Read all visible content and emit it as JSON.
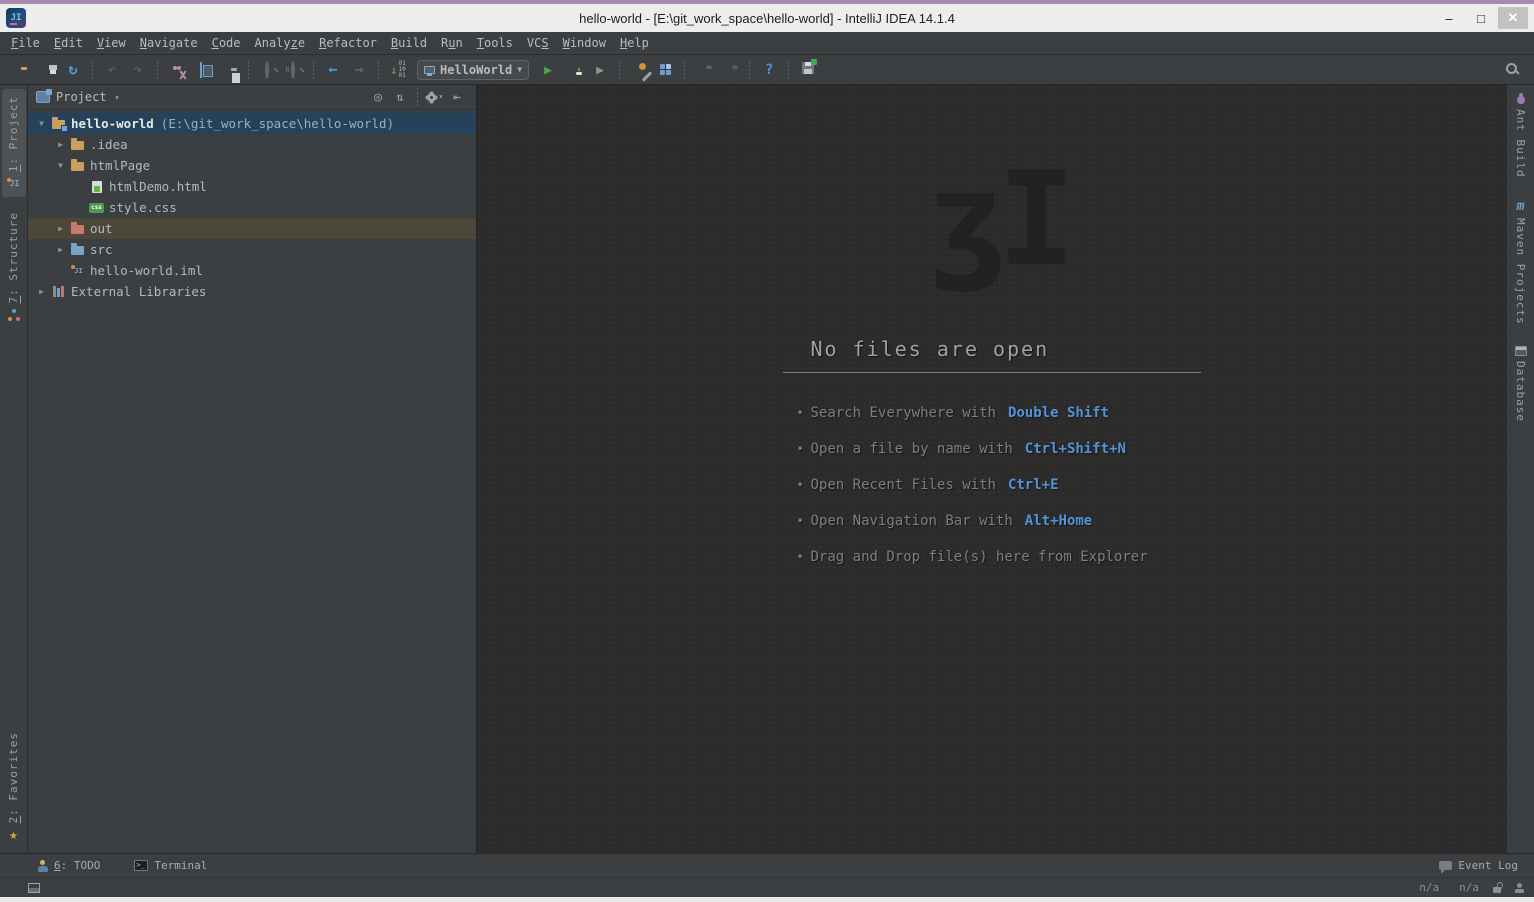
{
  "colors": {
    "accent_blue": "#5394D7",
    "selection_blue": "#25415C",
    "drop_highlight_olive": "#4B4839",
    "panel_gray": "#3C3F41",
    "editor_gray": "#2B2B2B",
    "run_green": "#4CA64C",
    "titlebar_light": "#EDEDED",
    "top_strip_purple": "#A98BB0",
    "folder_tan": "#C9A05F",
    "excluded_folder_red": "#C87B6C",
    "source_folder_blue": "#7CA2C8"
  },
  "titlebar": {
    "logo_text": "JI",
    "title": "hello-world - [E:\\git_work_space\\hello-world] - IntelliJ IDEA 14.1.4",
    "controls": {
      "minimize": "–",
      "maximize": "□",
      "close": "✕"
    }
  },
  "menu": {
    "items": [
      {
        "label": "File",
        "m": 0
      },
      {
        "label": "Edit",
        "m": 0
      },
      {
        "label": "View",
        "m": 0
      },
      {
        "label": "Navigate",
        "m": 0
      },
      {
        "label": "Code",
        "m": 0
      },
      {
        "label": "Analyze",
        "m": 5
      },
      {
        "label": "Refactor",
        "m": 0
      },
      {
        "label": "Build",
        "m": 0
      },
      {
        "label": "Run",
        "m": 1
      },
      {
        "label": "Tools",
        "m": 0
      },
      {
        "label": "VCS",
        "m": 2
      },
      {
        "label": "Window",
        "m": 0
      },
      {
        "label": "Help",
        "m": 0
      }
    ]
  },
  "toolbar": {
    "left_items": [
      {
        "icon": "open-folder",
        "name": "open"
      },
      {
        "icon": "save-all",
        "name": "save-all"
      },
      {
        "icon": "synchronize",
        "name": "synchronize"
      },
      {
        "sep": true
      },
      {
        "icon": "undo",
        "name": "undo",
        "disabled": true
      },
      {
        "icon": "redo",
        "name": "redo",
        "disabled": true
      },
      {
        "sep": true
      },
      {
        "icon": "cut",
        "name": "cut"
      },
      {
        "icon": "copy",
        "name": "copy"
      },
      {
        "icon": "paste",
        "name": "paste"
      },
      {
        "sep": true
      },
      {
        "icon": "find",
        "name": "find",
        "disabled": true
      },
      {
        "icon": "replace",
        "name": "replace",
        "disabled": true
      },
      {
        "sep": true
      },
      {
        "icon": "back",
        "name": "back"
      },
      {
        "icon": "forward",
        "name": "forward",
        "disabled": true
      },
      {
        "sep": true
      },
      {
        "icon": "binary-download",
        "name": "binary-download"
      }
    ],
    "run_config": "HelloWorld",
    "combo_caret": "▼",
    "right_items": [
      {
        "icon": "run",
        "name": "run"
      },
      {
        "icon": "debug",
        "name": "debug"
      },
      {
        "icon": "coverage",
        "name": "run-with-coverage"
      },
      {
        "sep": true
      },
      {
        "icon": "settings-wrench",
        "name": "settings"
      },
      {
        "icon": "project-structure",
        "name": "project-structure"
      },
      {
        "sep": true
      },
      {
        "icon": "android-deploy",
        "name": "android-deploy",
        "disabled": true
      },
      {
        "icon": "android",
        "name": "android-monitor",
        "disabled": true
      },
      {
        "sep": true
      },
      {
        "icon": "help",
        "name": "help"
      },
      {
        "sep": true
      },
      {
        "icon": "save-plugin",
        "name": "save-as-template"
      }
    ]
  },
  "project_panel": {
    "header": {
      "title": "Project",
      "caret": "▾",
      "buttons": [
        {
          "icon": "locate",
          "name": "scroll-to-source"
        },
        {
          "icon": "collapse-all",
          "name": "collapse-all"
        },
        {
          "sep": true
        },
        {
          "icon": "settings-gear",
          "name": "view-options"
        },
        {
          "icon": "hide",
          "name": "hide-panel"
        }
      ]
    },
    "tree": [
      {
        "level": 0,
        "arrow": "expanded",
        "icon": "folder-project",
        "label": "hello-world",
        "path": "(E:\\git_work_space\\hello-world)",
        "selected": true,
        "bold": true
      },
      {
        "level": 1,
        "arrow": "collapsed",
        "icon": "folder",
        "label": ".idea"
      },
      {
        "level": 1,
        "arrow": "expanded",
        "icon": "folder",
        "label": "htmlPage"
      },
      {
        "level": 2,
        "arrow": "none",
        "icon": "file-html",
        "label": "htmlDemo.html"
      },
      {
        "level": 2,
        "arrow": "none",
        "icon": "file-css",
        "label": "style.css"
      },
      {
        "level": 1,
        "arrow": "collapsed",
        "icon": "folder-excluded",
        "label": "out",
        "highlight": true
      },
      {
        "level": 1,
        "arrow": "collapsed",
        "icon": "folder-source",
        "label": "src"
      },
      {
        "level": 1,
        "arrow": "none",
        "icon": "file-iml",
        "label": "hello-world.iml"
      },
      {
        "level": 0,
        "arrow": "collapsed",
        "icon": "libraries",
        "label": "External Libraries"
      }
    ]
  },
  "editor": {
    "heading": "No files are open",
    "bullet": "•",
    "tips": [
      {
        "text": "Search Everywhere with",
        "shortcut": "Double Shift"
      },
      {
        "text": "Open a file by name with",
        "shortcut": "Ctrl+Shift+N"
      },
      {
        "text": "Open Recent Files with",
        "shortcut": "Ctrl+E"
      },
      {
        "text": "Open Navigation Bar with",
        "shortcut": "Alt+Home"
      },
      {
        "text": "Drag and Drop file(s) here from Explorer",
        "shortcut": ""
      }
    ]
  },
  "left_strip": {
    "top": [
      {
        "label": "1: Project",
        "m": 0,
        "icon": "project-tool",
        "active": true
      },
      {
        "label": "7: Structure",
        "m": 0,
        "icon": "structure-tool"
      }
    ],
    "bottom": [
      {
        "label": "2: Favorites",
        "m": 0,
        "icon": "star"
      }
    ]
  },
  "right_strip": {
    "items": [
      {
        "label": "Ant Build",
        "icon": "ant"
      },
      {
        "label": "Maven Projects",
        "icon": "maven"
      },
      {
        "label": "Database",
        "icon": "database"
      }
    ]
  },
  "bottom_bar": {
    "left": [
      {
        "label": "6: TODO",
        "m": 0,
        "icon": "todo"
      },
      {
        "label": "Terminal",
        "icon": "terminal"
      }
    ],
    "right": [
      {
        "label": "Event Log",
        "icon": "event-log"
      }
    ]
  },
  "status_bar": {
    "left_icons": [
      {
        "icon": "toggle-buttons",
        "name": "toggle-toolwindow-buttons"
      }
    ],
    "values": [
      {
        "value": "n/a"
      },
      {
        "value": "n/a"
      }
    ],
    "right_icons": [
      {
        "icon": "unlock",
        "name": "unlock"
      },
      {
        "icon": "hector",
        "name": "hector-inspector"
      }
    ]
  }
}
